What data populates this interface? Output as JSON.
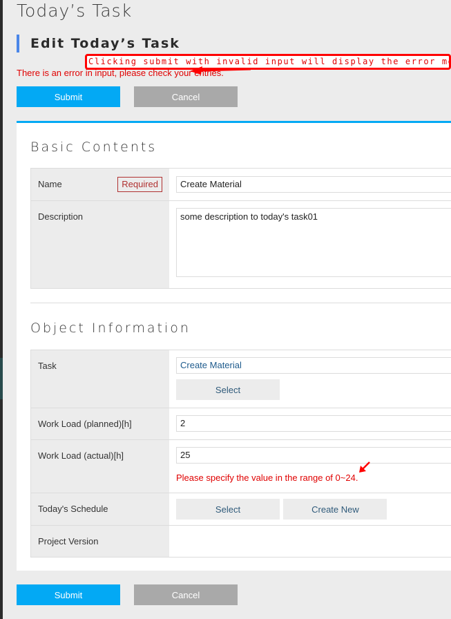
{
  "page": {
    "title": "Today’s Task",
    "section_heading": "Edit Today’s Task",
    "form_error": "There is an error in input, please check your entries.",
    "annotation": "Clicking submit with invalid input will display the error message"
  },
  "actions": {
    "submit_label": "Submit",
    "cancel_label": "Cancel"
  },
  "basic_contents": {
    "title": "Basic Contents",
    "name_label": "Name",
    "required_badge": "Required",
    "name_value": "Create Material",
    "description_label": "Description",
    "description_value": "some description to today's task01"
  },
  "object_information": {
    "title": "Object Information",
    "task_label": "Task",
    "task_value": "Create Material",
    "task_select_label": "Select",
    "planned_label": "Work Load (planned)[h]",
    "planned_value": "2",
    "actual_label": "Work Load (actual)[h]",
    "actual_value": "25",
    "actual_error": "Please specify the value in the range of 0~24.",
    "schedule_label": "Today's Schedule",
    "schedule_select_label": "Select",
    "schedule_create_label": "Create New",
    "project_version_label": "Project Version",
    "project_version_value": ""
  },
  "colors": {
    "accent": "#03a9f4",
    "heading_bar": "#4a86e8",
    "error": "#e00000",
    "required": "#b03030",
    "cancel": "#a9a9a9"
  }
}
